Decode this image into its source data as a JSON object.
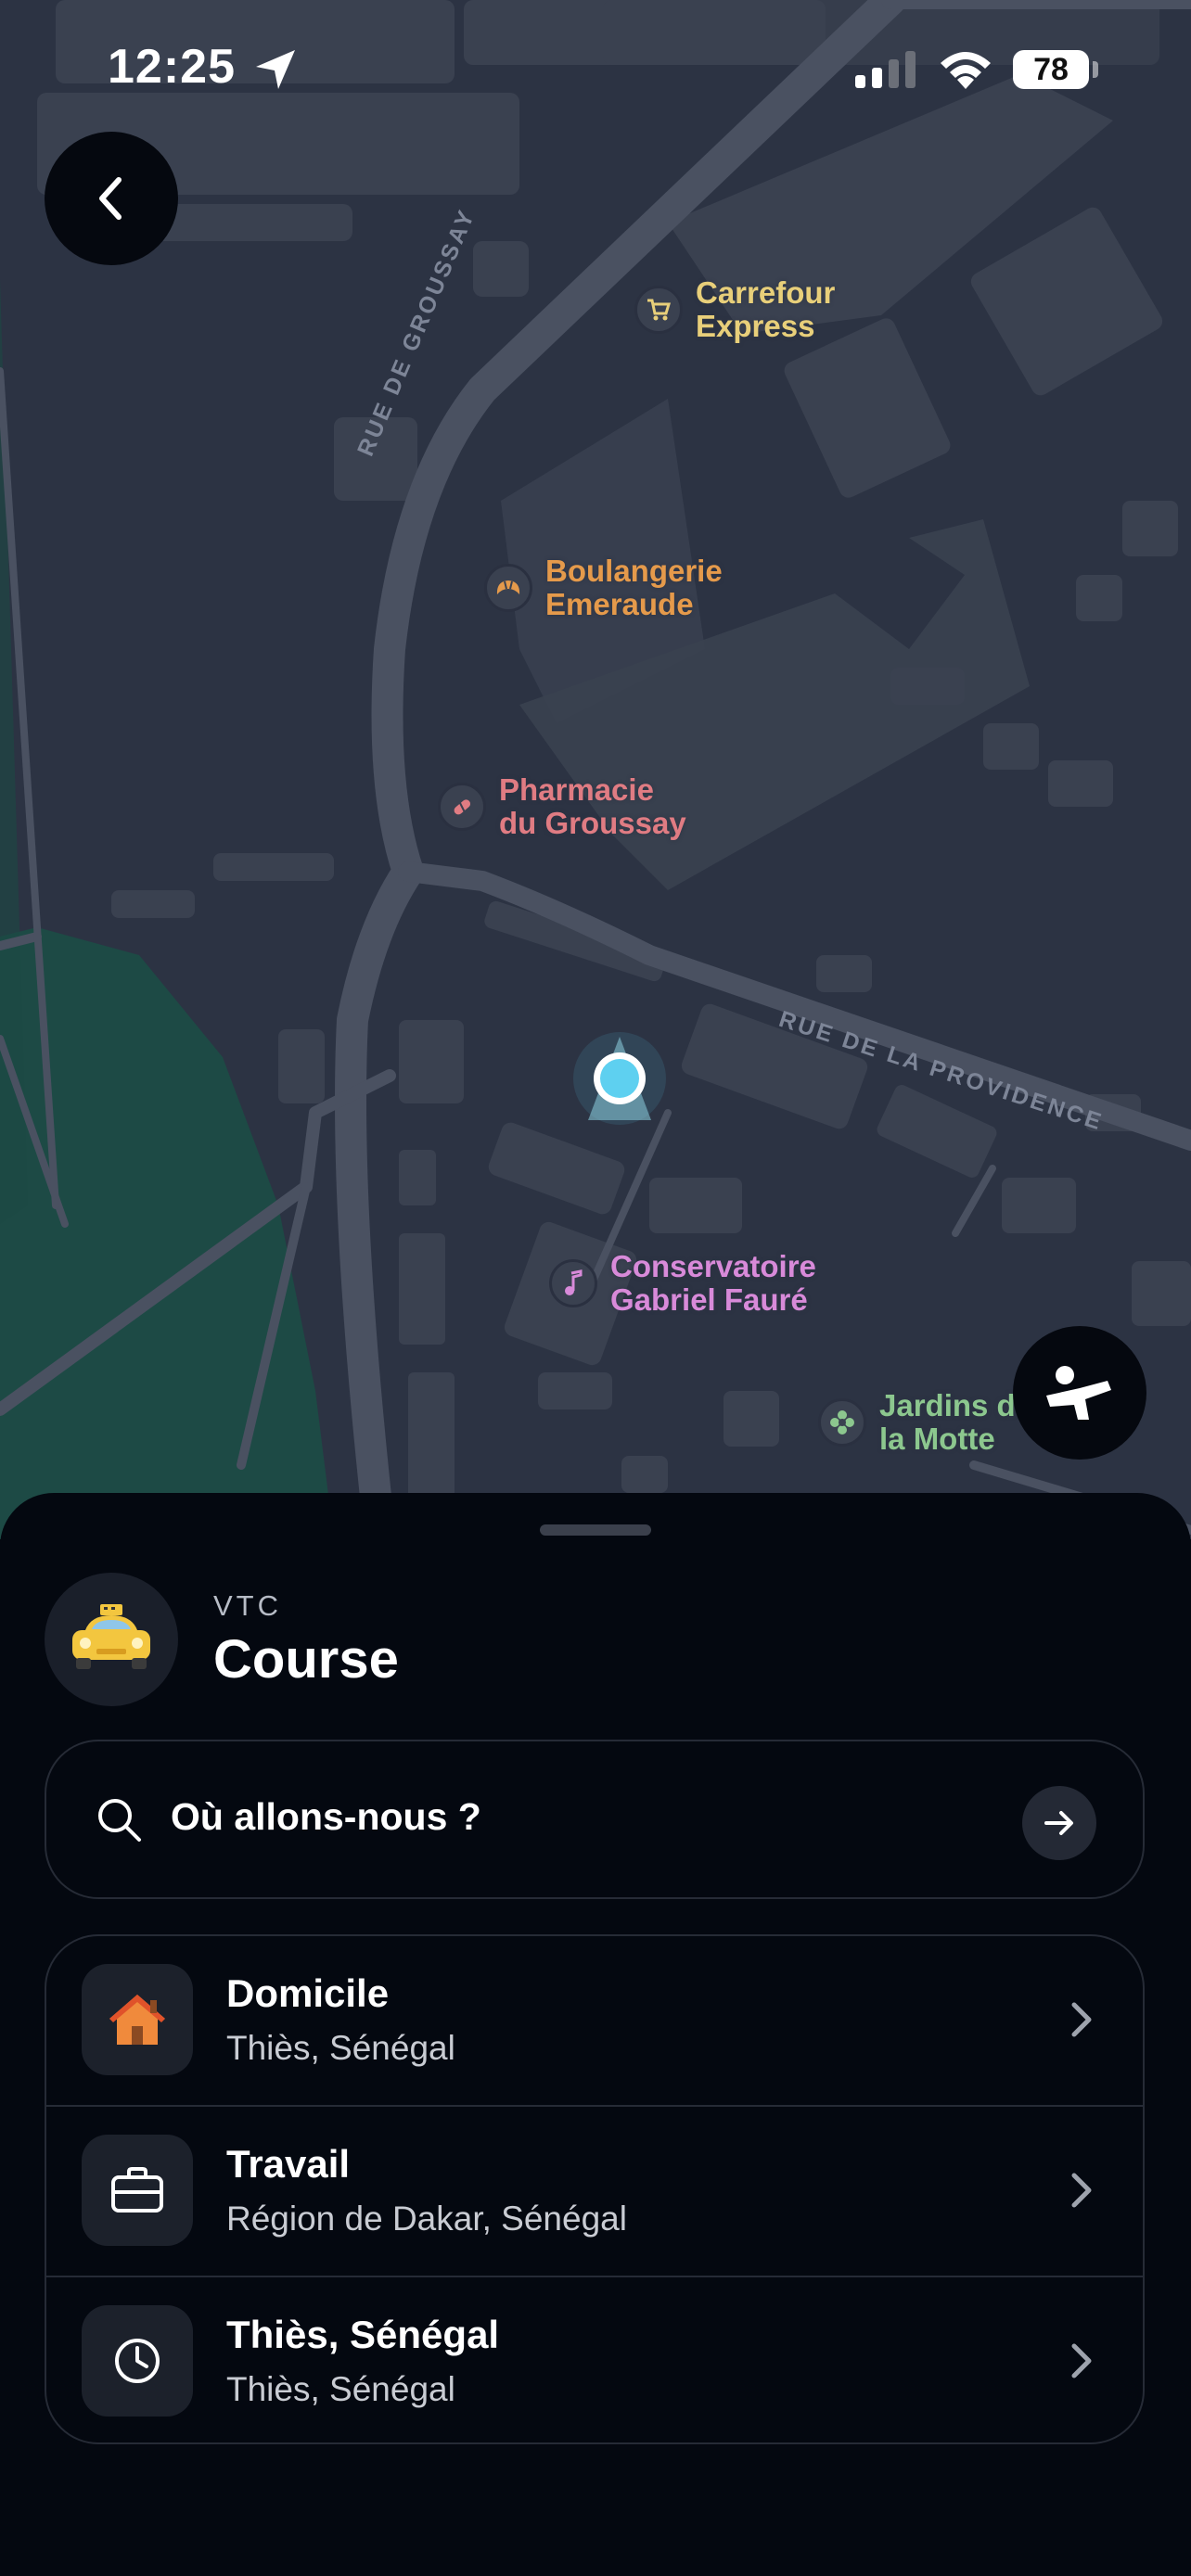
{
  "status_bar": {
    "time": "12:25",
    "battery": "78"
  },
  "map": {
    "pois": [
      {
        "name": "Carrefour\nExpress",
        "icon": "shopping-cart-icon",
        "color": "#e8cf7a"
      },
      {
        "name": "Boulangerie\nEmeraude",
        "icon": "croissant-icon",
        "color": "#e59a4b"
      },
      {
        "name": "Pharmacie\ndu Groussay",
        "icon": "pill-icon",
        "color": "#e07c83"
      },
      {
        "name": "Conservatoire\nGabriel Fauré",
        "icon": "music-note-icon",
        "color": "#d88ad9"
      },
      {
        "name": "Jardins de\nla Motte",
        "icon": "flower-icon",
        "color": "#8cc78e"
      }
    ],
    "streets": [
      "RUE DE GROUSSAY",
      "RUE DE LA PROVIDENCE"
    ]
  },
  "sheet": {
    "kicker": "VTC",
    "title": "Course",
    "search": {
      "placeholder": "Où allons-nous ?"
    },
    "places": [
      {
        "title": "Domicile",
        "subtitle": "Thiès, Sénégal",
        "icon": "home-icon"
      },
      {
        "title": "Travail",
        "subtitle": "Région de Dakar, Sénégal",
        "icon": "briefcase-icon"
      },
      {
        "title": "Thiès, Sénégal",
        "subtitle": "Thiès, Sénégal",
        "icon": "clock-icon"
      }
    ]
  },
  "colors": {
    "map_background": "#2c3343",
    "building": "#3a4150",
    "road": "#4a5161",
    "park": "#1d4a45",
    "sheet_background": "#040810",
    "location_dot": "#5ed0f0"
  }
}
